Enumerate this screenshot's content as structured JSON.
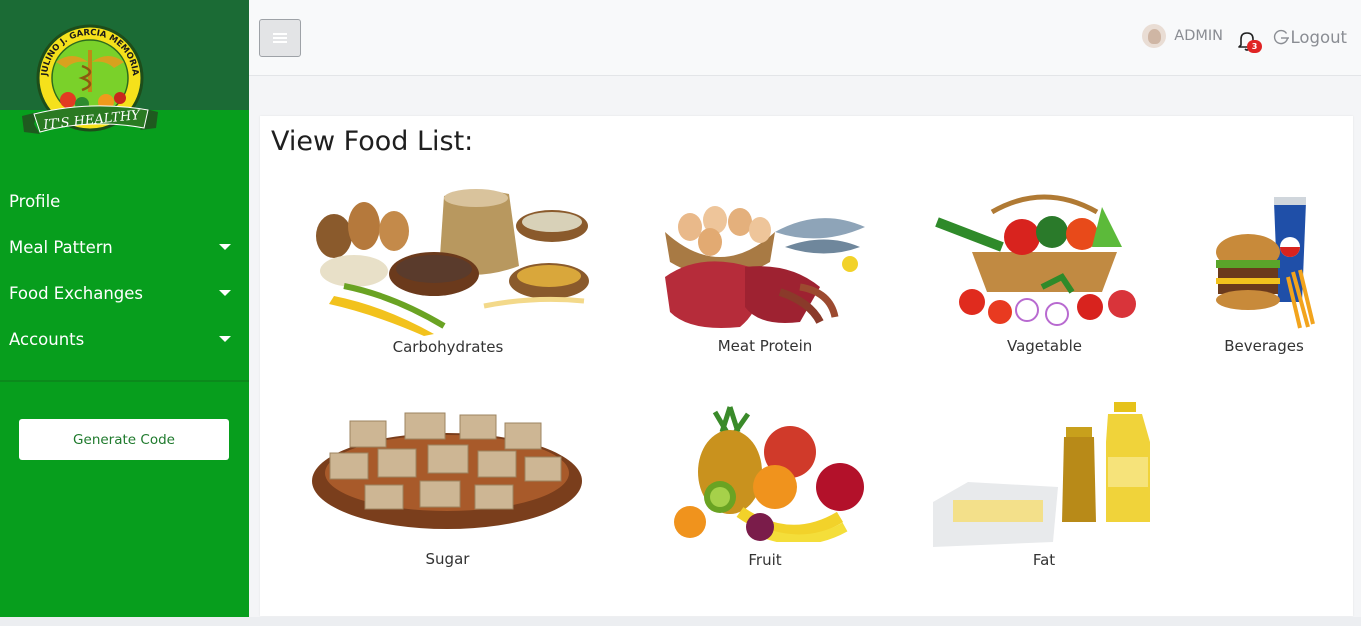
{
  "sidebar": {
    "logo": {
      "ring_text": "JULINO J. GARCIA MEMORIAL RESEARCH AND MEDICAL C",
      "ribbon_text": "IT'S HEALTHY"
    },
    "nav": [
      {
        "label": "Profile",
        "has_caret": false
      },
      {
        "label": "Meal Pattern",
        "has_caret": true
      },
      {
        "label": "Food Exchanges",
        "has_caret": true
      },
      {
        "label": "Accounts",
        "has_caret": true
      }
    ],
    "generate_button": "Generate Code"
  },
  "topbar": {
    "user_name": "ADMIN",
    "notification_count": "3",
    "logout_label": "Logout"
  },
  "content": {
    "title": "View Food List:",
    "foods": [
      {
        "label": "Carbohydrates",
        "icon": "grains-bread-corn-image"
      },
      {
        "label": "Meat Protein",
        "icon": "eggs-meat-fish-image"
      },
      {
        "label": "Vagetable",
        "icon": "vegetable-basket-image"
      },
      {
        "label": "Beverages",
        "icon": "burger-soda-fries-image"
      },
      {
        "label": "Sugar",
        "icon": "sugar-cubes-bowl-image"
      },
      {
        "label": "Fruit",
        "icon": "fruit-pile-image"
      },
      {
        "label": "Fat",
        "icon": "butter-oil-bottles-image"
      }
    ]
  },
  "colors": {
    "sidebar_green": "#079e1d",
    "logo_band": "#1b6b35",
    "badge_red": "#e02424"
  }
}
